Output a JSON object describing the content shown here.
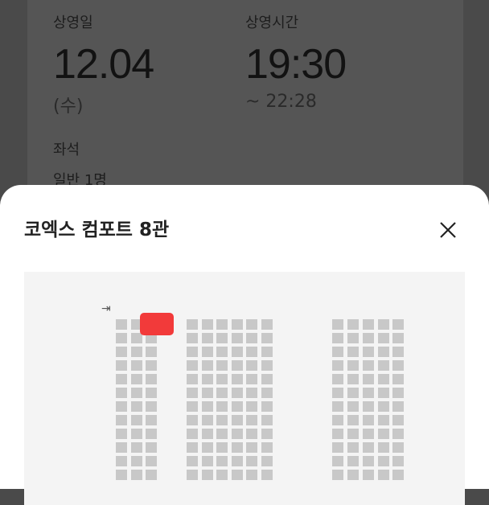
{
  "ticket": {
    "date_label": "상영일",
    "date": "12.04",
    "weekday": "(수)",
    "time_label": "상영시간",
    "start_time": "19:30",
    "end_time": "~ 22:28",
    "seat_label": "좌석",
    "seat_value": "일반 1명"
  },
  "sheet": {
    "title": "코엑스 컴포트 8관",
    "close_icon": "close-icon",
    "entrance_icon": "entrance-icon"
  },
  "seat_map": {
    "selected_color": "#f23a3a",
    "seat_color": "#c8c8c8",
    "blocks": [
      {
        "cols": 3
      },
      {
        "cols": 6
      },
      {
        "cols": 2
      },
      {
        "cols": 3
      }
    ]
  }
}
